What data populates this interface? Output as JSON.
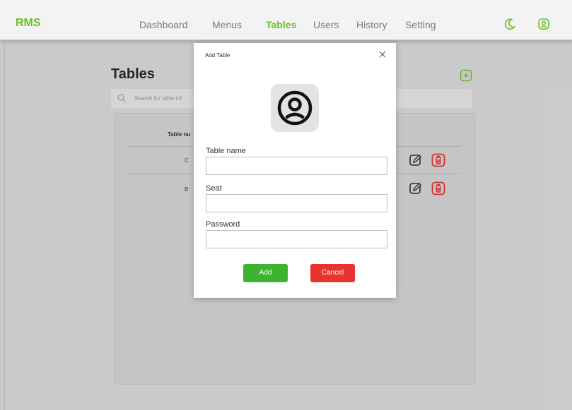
{
  "app": {
    "logo": "RMS"
  },
  "nav": {
    "items": [
      {
        "label": "Dashboard"
      },
      {
        "label": "Menus"
      },
      {
        "label": "Tables",
        "active": true
      },
      {
        "label": "Users"
      },
      {
        "label": "History"
      },
      {
        "label": "Setting"
      }
    ],
    "icons": [
      "moon-icon",
      "user-circle-icon"
    ]
  },
  "page": {
    "title": "Tables",
    "search_placeholder": "Search for table inf",
    "table": {
      "column_header": "Table nu",
      "rows": [
        {
          "name": "C"
        },
        {
          "name": "B"
        }
      ]
    }
  },
  "modal": {
    "title": "Add Table",
    "fields": {
      "table_name": {
        "label": "Table name",
        "value": ""
      },
      "seat": {
        "label": "Seat",
        "value": ""
      },
      "password": {
        "label": "Password",
        "value": ""
      }
    },
    "add_label": "Add",
    "cancel_label": "Cancel"
  },
  "colors": {
    "accent": "#6bbf2a",
    "add_button": "#3db330",
    "cancel_button": "#e8332f",
    "delete_icon": "#e8332f"
  }
}
